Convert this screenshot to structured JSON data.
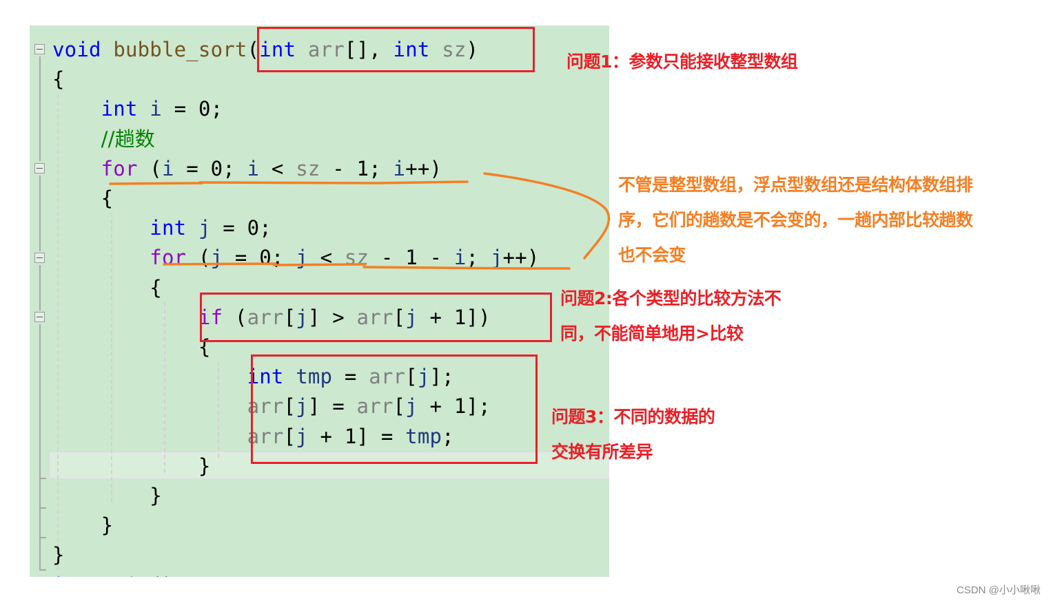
{
  "editor": {
    "lines": [
      {
        "tokens": [
          [
            "kw",
            "void"
          ],
          [
            "",
            "&nbsp;"
          ],
          [
            "fn",
            "bubble_sort"
          ],
          [
            "",
            "("
          ],
          [
            "kw",
            "int"
          ],
          [
            "",
            "&nbsp;"
          ],
          [
            "param",
            "arr"
          ],
          [
            "",
            "[],&nbsp;"
          ],
          [
            "kw",
            "int"
          ],
          [
            "",
            "&nbsp;"
          ],
          [
            "param",
            "sz"
          ],
          [
            "",
            ")"
          ]
        ]
      },
      {
        "tokens": [
          [
            "",
            "{"
          ]
        ]
      },
      {
        "tokens": [
          [
            "",
            "&nbsp;&nbsp;&nbsp;&nbsp;"
          ],
          [
            "kw",
            "int"
          ],
          [
            "",
            "&nbsp;"
          ],
          [
            "loc",
            "i"
          ],
          [
            "",
            "&nbsp;=&nbsp;0;"
          ]
        ]
      },
      {
        "tokens": [
          [
            "",
            "&nbsp;&nbsp;&nbsp;&nbsp;"
          ],
          [
            "cmt",
            "//趟数"
          ]
        ]
      },
      {
        "tokens": [
          [
            "",
            "&nbsp;&nbsp;&nbsp;&nbsp;"
          ],
          [
            "ctl",
            "for"
          ],
          [
            "",
            "&nbsp;("
          ],
          [
            "loc",
            "i"
          ],
          [
            "",
            "&nbsp;=&nbsp;0;&nbsp;"
          ],
          [
            "loc",
            "i"
          ],
          [
            "",
            "&nbsp;&lt;&nbsp;"
          ],
          [
            "param",
            "sz"
          ],
          [
            "",
            "&nbsp;-&nbsp;1;&nbsp;"
          ],
          [
            "loc",
            "i"
          ],
          [
            "",
            "++)"
          ]
        ]
      },
      {
        "tokens": [
          [
            "",
            "&nbsp;&nbsp;&nbsp;&nbsp;{"
          ]
        ]
      },
      {
        "tokens": [
          [
            "",
            "&nbsp;&nbsp;&nbsp;&nbsp;&nbsp;&nbsp;&nbsp;&nbsp;"
          ],
          [
            "kw",
            "int"
          ],
          [
            "",
            "&nbsp;"
          ],
          [
            "loc",
            "j"
          ],
          [
            "",
            "&nbsp;=&nbsp;0;"
          ]
        ]
      },
      {
        "tokens": [
          [
            "",
            "&nbsp;&nbsp;&nbsp;&nbsp;&nbsp;&nbsp;&nbsp;&nbsp;"
          ],
          [
            "ctl",
            "for"
          ],
          [
            "",
            "&nbsp;("
          ],
          [
            "loc",
            "j"
          ],
          [
            "",
            "&nbsp;=&nbsp;0;&nbsp;"
          ],
          [
            "loc",
            "j"
          ],
          [
            "",
            "&nbsp;&lt;&nbsp;"
          ],
          [
            "param",
            "sz"
          ],
          [
            "",
            "&nbsp;-&nbsp;1&nbsp;-&nbsp;"
          ],
          [
            "loc",
            "i"
          ],
          [
            "",
            ";&nbsp;"
          ],
          [
            "loc",
            "j"
          ],
          [
            "",
            "++)"
          ]
        ]
      },
      {
        "tokens": [
          [
            "",
            "&nbsp;&nbsp;&nbsp;&nbsp;&nbsp;&nbsp;&nbsp;&nbsp;{"
          ]
        ]
      },
      {
        "tokens": [
          [
            "",
            "&nbsp;&nbsp;&nbsp;&nbsp;&nbsp;&nbsp;&nbsp;&nbsp;&nbsp;&nbsp;&nbsp;&nbsp;"
          ],
          [
            "ctl",
            "if"
          ],
          [
            "",
            "&nbsp;("
          ],
          [
            "param",
            "arr"
          ],
          [
            "",
            "["
          ],
          [
            "loc",
            "j"
          ],
          [
            "",
            "]&nbsp;&gt;&nbsp;"
          ],
          [
            "param",
            "arr"
          ],
          [
            "",
            "["
          ],
          [
            "loc",
            "j"
          ],
          [
            "",
            "&nbsp;+&nbsp;1])"
          ]
        ]
      },
      {
        "tokens": [
          [
            "",
            "&nbsp;&nbsp;&nbsp;&nbsp;&nbsp;&nbsp;&nbsp;&nbsp;&nbsp;&nbsp;&nbsp;&nbsp;{"
          ]
        ]
      },
      {
        "tokens": [
          [
            "",
            "&nbsp;&nbsp;&nbsp;&nbsp;&nbsp;&nbsp;&nbsp;&nbsp;&nbsp;&nbsp;&nbsp;&nbsp;&nbsp;&nbsp;&nbsp;&nbsp;"
          ],
          [
            "kw",
            "int"
          ],
          [
            "",
            "&nbsp;"
          ],
          [
            "loc",
            "tmp"
          ],
          [
            "",
            "&nbsp;=&nbsp;"
          ],
          [
            "param",
            "arr"
          ],
          [
            "",
            "["
          ],
          [
            "loc",
            "j"
          ],
          [
            "",
            "];"
          ]
        ]
      },
      {
        "tokens": [
          [
            "",
            "&nbsp;&nbsp;&nbsp;&nbsp;&nbsp;&nbsp;&nbsp;&nbsp;&nbsp;&nbsp;&nbsp;&nbsp;&nbsp;&nbsp;&nbsp;&nbsp;"
          ],
          [
            "param",
            "arr"
          ],
          [
            "",
            "["
          ],
          [
            "loc",
            "j"
          ],
          [
            "",
            "]&nbsp;=&nbsp;"
          ],
          [
            "param",
            "arr"
          ],
          [
            "",
            "["
          ],
          [
            "loc",
            "j"
          ],
          [
            "",
            "&nbsp;+&nbsp;1];"
          ]
        ]
      },
      {
        "tokens": [
          [
            "",
            "&nbsp;&nbsp;&nbsp;&nbsp;&nbsp;&nbsp;&nbsp;&nbsp;&nbsp;&nbsp;&nbsp;&nbsp;&nbsp;&nbsp;&nbsp;&nbsp;"
          ],
          [
            "param",
            "arr"
          ],
          [
            "",
            "["
          ],
          [
            "loc",
            "j"
          ],
          [
            "",
            "&nbsp;+&nbsp;1]&nbsp;=&nbsp;"
          ],
          [
            "loc",
            "tmp"
          ],
          [
            "",
            ";"
          ]
        ]
      },
      {
        "tokens": [
          [
            "",
            "&nbsp;&nbsp;&nbsp;&nbsp;&nbsp;&nbsp;&nbsp;&nbsp;&nbsp;&nbsp;&nbsp;&nbsp;}"
          ]
        ]
      },
      {
        "tokens": [
          [
            "",
            "&nbsp;&nbsp;&nbsp;&nbsp;&nbsp;&nbsp;&nbsp;&nbsp;}"
          ]
        ]
      },
      {
        "tokens": [
          [
            "",
            "&nbsp;&nbsp;&nbsp;&nbsp;}"
          ]
        ]
      },
      {
        "tokens": [
          [
            "",
            "}"
          ]
        ]
      },
      {
        "tokens": [
          [
            "kw",
            "int"
          ],
          [
            "",
            "&nbsp;"
          ],
          [
            "fn",
            "main"
          ],
          [
            "",
            "()"
          ]
        ]
      }
    ]
  },
  "annotations": {
    "problem1": "问题1：参数只能接收整型数组",
    "common_note": [
      "不管是整型数组，浮点型数组还是结构体数组排",
      "序，它们的趟数是不会变的，一趟内部比较趟数",
      "也不会变"
    ],
    "problem2": [
      "问题2:各个类型的比较方法不",
      "同，不能简单地用>比较"
    ],
    "problem3": [
      "问题3：不同的数据的",
      "交换有所差异"
    ]
  },
  "colors": {
    "editor_bg": "#cce8cf",
    "highlight_box": "#e8202a",
    "orange_mark": "#f47f24",
    "keyword": "#0000ff",
    "control": "#8f08c4",
    "function": "#74531f",
    "parameter": "#808080",
    "local": "#1f377f",
    "comment": "#008000"
  },
  "watermark": "CSDN @小小啾啾"
}
